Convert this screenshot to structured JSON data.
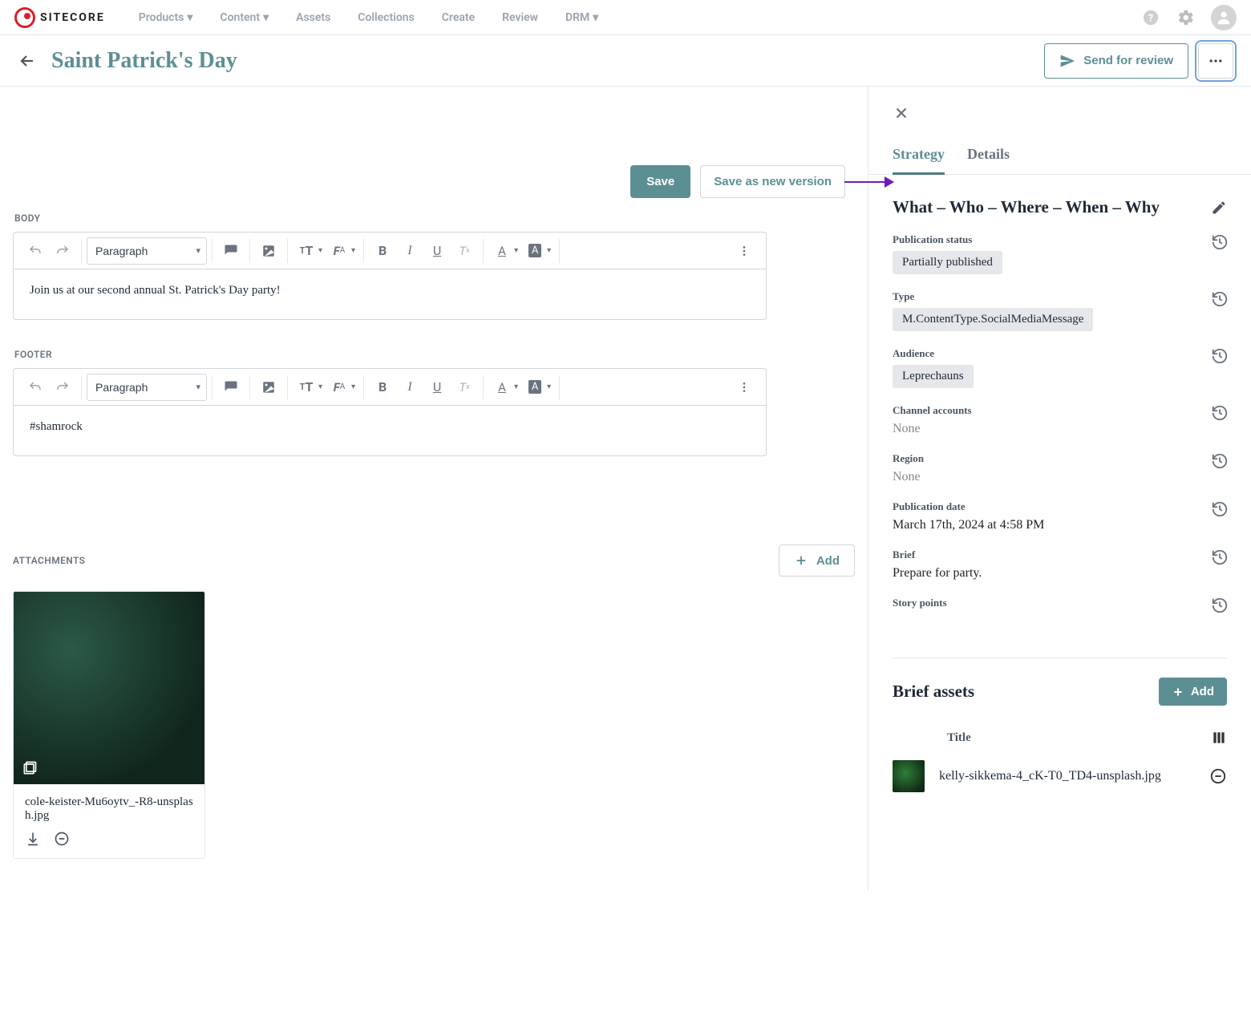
{
  "brand": "SITECORE",
  "nav": {
    "products": "Products",
    "content": "Content",
    "assets": "Assets",
    "collections": "Collections",
    "create": "Create",
    "review": "Review",
    "drm": "DRM"
  },
  "page": {
    "title": "Saint Patrick's Day",
    "send_for_review": "Send for review"
  },
  "editor": {
    "save": "Save",
    "save_as_new_version": "Save as new version",
    "body_label": "BODY",
    "footer_label": "FOOTER",
    "paragraph": "Paragraph",
    "body_text": "Join us at our second annual St. Patrick's Day party!",
    "footer_text": "#shamrock"
  },
  "attachments": {
    "label": "ATTACHMENTS",
    "add": "Add",
    "items": [
      {
        "filename": "cole-keister-Mu6oytv_-R8-unsplash.jpg"
      }
    ]
  },
  "side": {
    "tabs": {
      "strategy": "Strategy",
      "details": "Details"
    },
    "heading": "What – Who – Where – When – Why",
    "fields": {
      "publication_status": {
        "label": "Publication status",
        "chip": "Partially published"
      },
      "type": {
        "label": "Type",
        "chip": "M.ContentType.SocialMediaMessage"
      },
      "audience": {
        "label": "Audience",
        "chip": "Leprechauns"
      },
      "channel_accounts": {
        "label": "Channel accounts",
        "value": "None",
        "is_none": true
      },
      "region": {
        "label": "Region",
        "value": "None",
        "is_none": true
      },
      "publication_date": {
        "label": "Publication date",
        "value": "March 17th, 2024 at 4:58 PM"
      },
      "brief": {
        "label": "Brief",
        "value": "Prepare for party."
      },
      "story_points": {
        "label": "Story points",
        "value": ""
      }
    },
    "brief_assets": {
      "heading": "Brief assets",
      "add": "Add",
      "title_header": "Title",
      "rows": [
        {
          "name": "kelly-sikkema-4_cK-T0_TD4-unsplash.jpg"
        }
      ]
    }
  }
}
